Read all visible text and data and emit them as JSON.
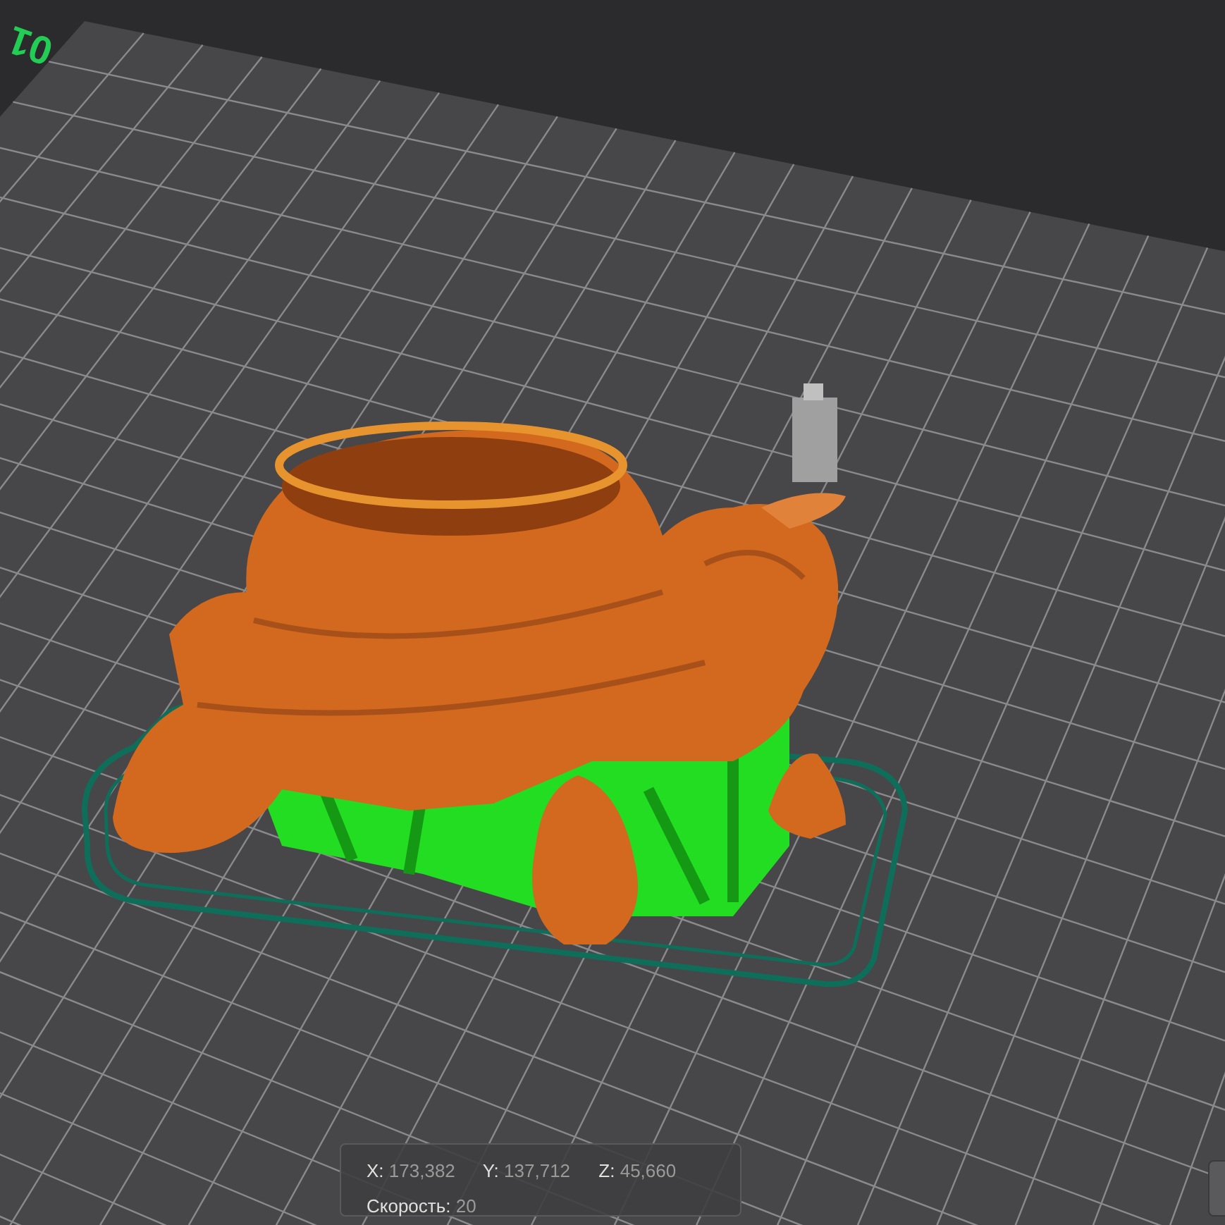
{
  "plate": {
    "label": "01"
  },
  "position_readout": {
    "coordinates": [
      {
        "label": "X:",
        "value": "173,382"
      },
      {
        "label": "Y:",
        "value": "137,712"
      },
      {
        "label": "Z:",
        "value": "45,660"
      }
    ],
    "speed": {
      "label": "Скорость:",
      "value": "20"
    }
  }
}
